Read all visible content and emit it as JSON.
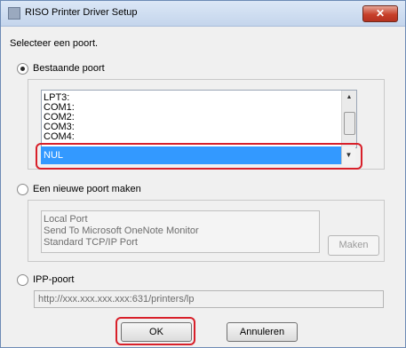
{
  "window": {
    "title": "RISO Printer Driver Setup",
    "close_symbol": "✕"
  },
  "prompt": "Selecteer een poort.",
  "existing_port": {
    "label": "Bestaande poort",
    "selected": true,
    "list": [
      "LPT3:",
      "COM1:",
      "COM2:",
      "COM3:",
      "COM4:"
    ],
    "selected_value": "NUL"
  },
  "new_port": {
    "label": "Een nieuwe poort maken",
    "selected": false,
    "list": [
      "Local Port",
      "Send To Microsoft OneNote Monitor",
      "Standard TCP/IP Port"
    ],
    "make_button": "Maken"
  },
  "ipp_port": {
    "label": "IPP-poort",
    "selected": false,
    "url_value": "http://xxx.xxx.xxx.xxx:631/printers/lp"
  },
  "buttons": {
    "ok": "OK",
    "cancel": "Annuleren"
  },
  "colors": {
    "highlight": "#d8202a",
    "selection": "#3399ff"
  }
}
